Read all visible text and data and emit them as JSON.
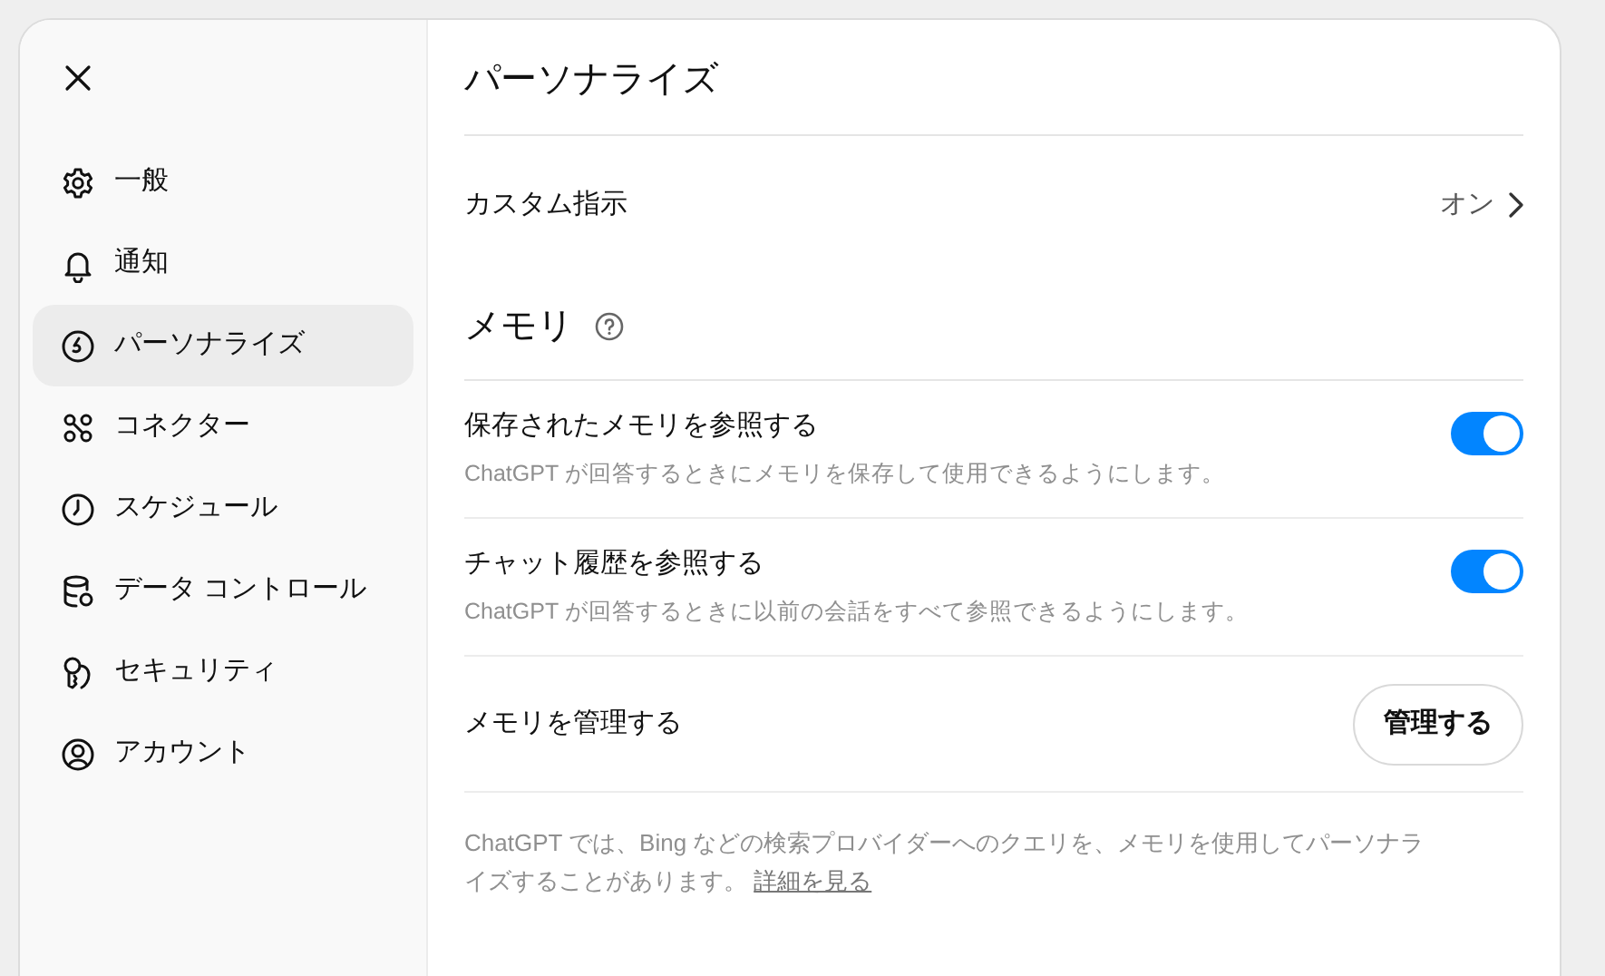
{
  "sidebar": {
    "items": [
      {
        "label": "一般",
        "selected": false
      },
      {
        "label": "通知",
        "selected": false
      },
      {
        "label": "パーソナライズ",
        "selected": true
      },
      {
        "label": "コネクター",
        "selected": false
      },
      {
        "label": "スケジュール",
        "selected": false
      },
      {
        "label": "データ コントロール",
        "selected": false
      },
      {
        "label": "セキュリティ",
        "selected": false
      },
      {
        "label": "アカウント",
        "selected": false
      }
    ]
  },
  "page_title": "パーソナライズ",
  "custom_instructions": {
    "label": "カスタム指示",
    "value": "オン"
  },
  "memory": {
    "title": "メモリ",
    "rows": [
      {
        "kind": "toggle",
        "label": "保存されたメモリを参照する",
        "description": "ChatGPT が回答するときにメモリを保存して使用できるようにします。",
        "on": true
      },
      {
        "kind": "toggle",
        "label": "チャット履歴を参照する",
        "description": "ChatGPT が回答するときに以前の会話をすべて参照できるようにします。",
        "on": true
      },
      {
        "kind": "button",
        "label": "メモリを管理する",
        "button": "管理する"
      }
    ],
    "note": {
      "text": "ChatGPT では、Bing などの検索プロバイダーへのクエリを、メモリを使用してパーソナライズすることがあります。",
      "link": "詳細を見る"
    }
  }
}
